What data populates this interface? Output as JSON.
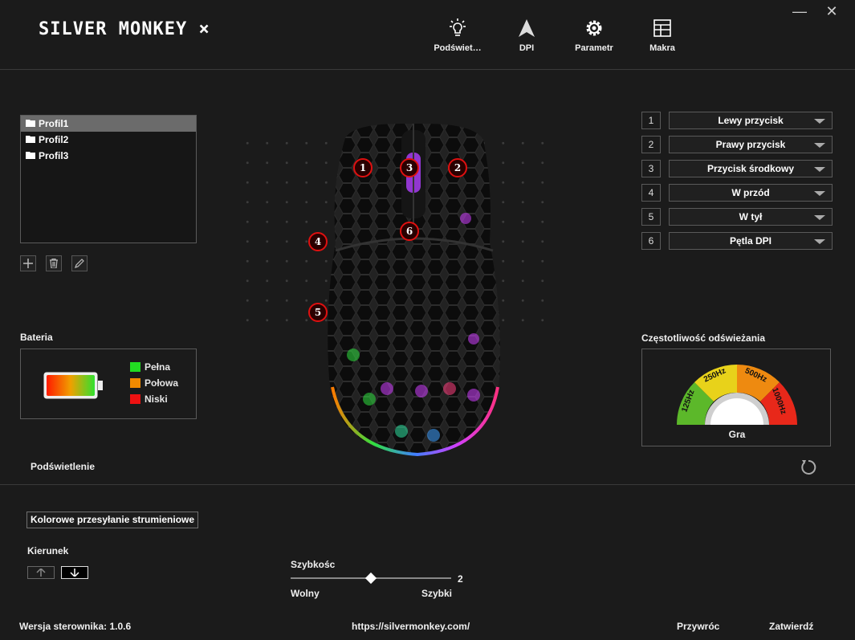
{
  "header": {
    "logo_text": "SILVER MONKEY",
    "logo_mark": "×",
    "minimize": "—",
    "close": "✕",
    "nav": [
      {
        "label": "Podświet…",
        "icon": "bulb-icon"
      },
      {
        "label": "DPI",
        "icon": "arrow-icon"
      },
      {
        "label": "Parametr",
        "icon": "gear-icon"
      },
      {
        "label": "Makra",
        "icon": "grid-icon"
      }
    ]
  },
  "profiles": {
    "items": [
      "Profil1",
      "Profil2",
      "Profil3"
    ],
    "selected": 0
  },
  "battery": {
    "title": "Bateria",
    "legend": [
      {
        "label": "Pełna",
        "color": "#22dd22"
      },
      {
        "label": "Połowa",
        "color": "#f08a00"
      },
      {
        "label": "Niski",
        "color": "#ee1111"
      }
    ]
  },
  "mouse_markers": [
    "1",
    "2",
    "3",
    "4",
    "5",
    "6"
  ],
  "buttons": [
    {
      "num": "1",
      "action": "Lewy przycisk"
    },
    {
      "num": "2",
      "action": "Prawy przycisk"
    },
    {
      "num": "3",
      "action": "Przycisk środkowy"
    },
    {
      "num": "4",
      "action": "W przód"
    },
    {
      "num": "5",
      "action": "W tył"
    },
    {
      "num": "6",
      "action": "Pętla DPI"
    }
  ],
  "polling": {
    "title": "Częstotliwość odświeżania",
    "rates": [
      "125Hz",
      "250Hz",
      "500Hz",
      "1000Hz"
    ],
    "colors": [
      "#5cb82a",
      "#e8d21a",
      "#ee8a10",
      "#e8281a"
    ],
    "mode": "Gra"
  },
  "lighting": {
    "title": "Podświetlenie",
    "mode_button": "Kolorowe przesyłanie strumieniowe",
    "direction_label": "Kierunek",
    "speed_label": "Szybkośc",
    "speed_value": "2",
    "slow_label": "Wolny",
    "fast_label": "Szybki"
  },
  "footer": {
    "version": "Wersja sterownika: 1.0.6",
    "url": "https://silvermonkey.com/",
    "restore": "Przywróc",
    "confirm": "Zatwierdź"
  }
}
